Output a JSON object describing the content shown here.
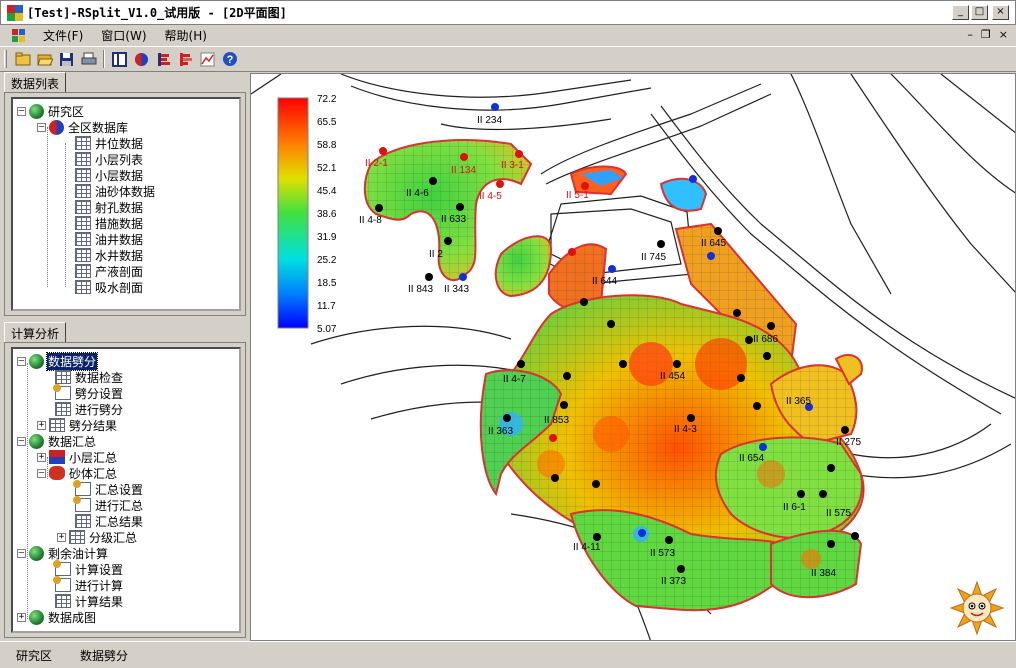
{
  "window": {
    "title": "[Test]-RSplit_V1.0_试用版 - [2D平面图]",
    "buttons": {
      "minimize": "_",
      "maximize": "□",
      "close": "×"
    }
  },
  "menu": {
    "items": [
      "文件(F)",
      "窗口(W)",
      "帮助(H)"
    ],
    "mdi_buttons": {
      "minimize": "–",
      "restore": "❐",
      "close": "×"
    }
  },
  "toolbar": {
    "buttons": [
      "new-icon",
      "open-icon",
      "save-icon",
      "print-icon",
      "layout-icon",
      "pie-icon",
      "bar-chart-icon",
      "bar-chart-red-icon",
      "line-chart-icon",
      "help-icon"
    ]
  },
  "data_list_pane": {
    "tab": "数据列表",
    "tree": {
      "root": "研究区",
      "db": "全区数据库",
      "items": [
        "井位数据",
        "小层列表",
        "小层数据",
        "油砂体数据",
        "射孔数据",
        "措施数据",
        "油井数据",
        "水井数据",
        "产液剖面",
        "吸水剖面"
      ]
    }
  },
  "analysis_pane": {
    "tab": "计算分析",
    "tree": {
      "split": {
        "label": "数据劈分",
        "children": [
          "数据检查",
          "劈分设置",
          "进行劈分",
          "劈分结果"
        ]
      },
      "summary": {
        "label": "数据汇总",
        "layer": "小层汇总",
        "sand": "砂体汇总",
        "sand_children": [
          "汇总设置",
          "进行汇总",
          "汇总结果",
          "分级汇总"
        ]
      },
      "remaining": {
        "label": "剩余油计算",
        "children": [
          "计算设置",
          "进行计算",
          "计算结果"
        ]
      },
      "mapping": {
        "label": "数据成图"
      }
    }
  },
  "colorbar": {
    "ticks": [
      "72.2",
      "65.5",
      "58.8",
      "52.1",
      "45.4",
      "38.6",
      "31.9",
      "25.2",
      "18.5",
      "11.7",
      "5.07"
    ]
  },
  "wells": [
    {
      "label": "II 234",
      "color": "blue"
    },
    {
      "label": "II 2-1",
      "color": "red"
    },
    {
      "label": "II 134",
      "color": "red"
    },
    {
      "label": "II 3-1",
      "color": "red"
    },
    {
      "label": "II 4-6",
      "color": "black"
    },
    {
      "label": "II 4-5",
      "color": "red"
    },
    {
      "label": "II 4-8",
      "color": "black"
    },
    {
      "label": "II 633",
      "color": "black"
    },
    {
      "label": "II 2",
      "color": "black"
    },
    {
      "label": "II 843",
      "color": "black"
    },
    {
      "label": "II 343",
      "color": "blue"
    },
    {
      "label": "II 5-1",
      "color": "red"
    },
    {
      "label": "II 644",
      "color": "blue"
    },
    {
      "label": "II 745",
      "color": "black"
    },
    {
      "label": "II 645",
      "color": "black"
    },
    {
      "label": "II 4-11",
      "color": "black"
    },
    {
      "label": "II 363",
      "color": "black"
    },
    {
      "label": "II 853",
      "color": "black"
    },
    {
      "label": "II 454",
      "color": "black"
    },
    {
      "label": "II 4-7",
      "color": "black"
    },
    {
      "label": "II 686",
      "color": "black"
    },
    {
      "label": "II 6-1",
      "color": "black"
    },
    {
      "label": "II 573",
      "color": "black"
    },
    {
      "label": "II 373",
      "color": "black"
    },
    {
      "label": "II 275",
      "color": "black"
    },
    {
      "label": "II 575",
      "color": "black"
    },
    {
      "label": "II 384",
      "color": "black"
    },
    {
      "label": "II 654",
      "color": "blue"
    },
    {
      "label": "II 365",
      "color": "black"
    },
    {
      "label": "II 4-3",
      "color": "black"
    }
  ],
  "status": {
    "items": [
      "研究区",
      "数据劈分"
    ]
  }
}
